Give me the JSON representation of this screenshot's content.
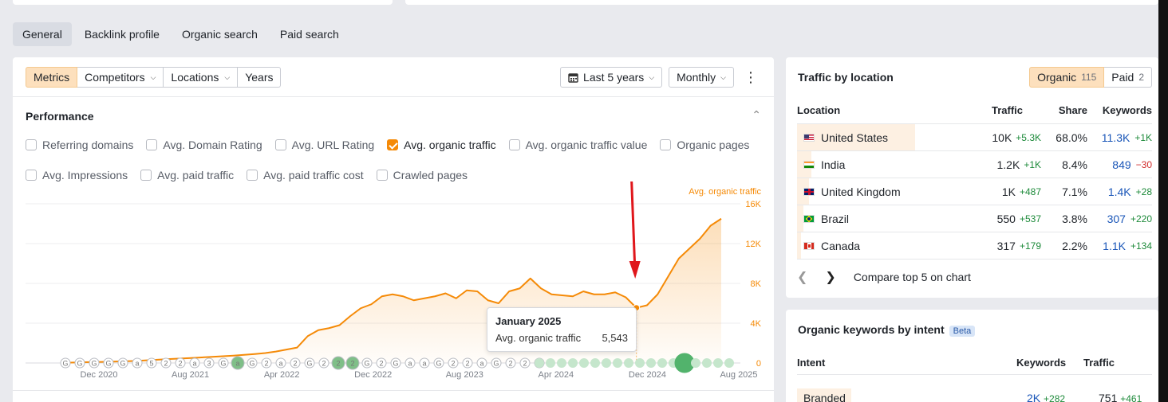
{
  "tabs": [
    "General",
    "Backlink profile",
    "Organic search",
    "Paid search"
  ],
  "toolbar": {
    "segments": [
      "Metrics",
      "Competitors",
      "Locations",
      "Years"
    ],
    "period": "Last 5 years",
    "interval": "Monthly"
  },
  "performance": {
    "title": "Performance",
    "metrics": [
      {
        "label": "Referring domains",
        "checked": false
      },
      {
        "label": "Avg. Domain Rating",
        "checked": false
      },
      {
        "label": "Avg. URL Rating",
        "checked": false
      },
      {
        "label": "Avg. organic traffic",
        "checked": true
      },
      {
        "label": "Avg. organic traffic value",
        "checked": false
      },
      {
        "label": "Organic pages",
        "checked": false
      },
      {
        "label": "Avg. Impressions",
        "checked": false
      },
      {
        "label": "Avg. paid traffic",
        "checked": false
      },
      {
        "label": "Avg. paid traffic cost",
        "checked": false
      },
      {
        "label": "Crawled pages",
        "checked": false
      }
    ]
  },
  "chart_data": {
    "type": "area",
    "series": [
      {
        "name": "Avg. organic traffic",
        "color": "#f58a07",
        "values": [
          20,
          50,
          80,
          100,
          120,
          150,
          180,
          220,
          280,
          340,
          400,
          450,
          500,
          560,
          620,
          680,
          740,
          820,
          900,
          1000,
          1150,
          1350,
          1550,
          2700,
          3300,
          3500,
          3800,
          4700,
          5500,
          5900,
          6700,
          6900,
          6700,
          6300,
          6500,
          6700,
          7000,
          6500,
          7300,
          7200,
          6300,
          6000,
          7200,
          7500,
          8500,
          7500,
          6900,
          6800,
          6700,
          7200,
          6900,
          6900,
          7100,
          6600,
          5543,
          5800,
          6900,
          8700,
          10500,
          11500,
          12500,
          13800,
          14500
        ]
      }
    ],
    "x_ticks": [
      "Dec 2020",
      "Aug 2021",
      "Apr 2022",
      "Dec 2022",
      "Aug 2023",
      "Apr 2024",
      "Dec 2024",
      "Aug 2025"
    ],
    "y_ticks": [
      "0",
      "4K",
      "8K",
      "12K",
      "16K"
    ],
    "ylim": [
      0,
      16000
    ],
    "legend": "Avg. organic traffic",
    "event_markers": [
      "G",
      "G",
      "G",
      "G",
      "G",
      "a",
      "5",
      "2",
      "2",
      "a",
      "3",
      "G",
      "a",
      "G",
      "2",
      "a",
      "2",
      "G",
      "2",
      "2",
      "2",
      "G",
      "2",
      "G",
      "a",
      "a",
      "G",
      "2",
      "2",
      "a",
      "G",
      "2",
      "2",
      "2"
    ]
  },
  "tooltip": {
    "date": "January 2025",
    "label": "Avg. organic traffic",
    "value": "5,543"
  },
  "traffic_by_location": {
    "title": "Traffic by location",
    "organic_label": "Organic",
    "organic_count": "115",
    "paid_label": "Paid",
    "paid_count": "2",
    "headers": {
      "location": "Location",
      "traffic": "Traffic",
      "share": "Share",
      "keywords": "Keywords"
    },
    "rows": [
      {
        "country": "United States",
        "flag": "us",
        "traffic": "10K",
        "traffic_delta": "+5.3K",
        "share": "68.0%",
        "share_pct": 68.0,
        "keywords": "11.3K",
        "kw_delta": "+1K",
        "kw_neg": false
      },
      {
        "country": "India",
        "flag": "in",
        "traffic": "1.2K",
        "traffic_delta": "+1K",
        "share": "8.4%",
        "share_pct": 8.4,
        "keywords": "849",
        "kw_delta": "−30",
        "kw_neg": true
      },
      {
        "country": "United Kingdom",
        "flag": "gb",
        "traffic": "1K",
        "traffic_delta": "+487",
        "share": "7.1%",
        "share_pct": 7.1,
        "keywords": "1.4K",
        "kw_delta": "+28",
        "kw_neg": false
      },
      {
        "country": "Brazil",
        "flag": "br",
        "traffic": "550",
        "traffic_delta": "+537",
        "share": "3.8%",
        "share_pct": 3.8,
        "keywords": "307",
        "kw_delta": "+220",
        "kw_neg": false
      },
      {
        "country": "Canada",
        "flag": "ca",
        "traffic": "317",
        "traffic_delta": "+179",
        "share": "2.2%",
        "share_pct": 2.2,
        "keywords": "1.1K",
        "kw_delta": "+134",
        "kw_neg": false
      }
    ],
    "compare_label": "Compare top 5 on chart"
  },
  "keywords_by_intent": {
    "title": "Organic keywords by intent",
    "badge": "Beta",
    "headers": {
      "intent": "Intent",
      "keywords": "Keywords",
      "traffic": "Traffic"
    },
    "rows": [
      {
        "intent": "Branded",
        "keywords": "2K",
        "kw_delta": "+282",
        "traffic": "751",
        "tr_delta": "+461"
      }
    ]
  }
}
